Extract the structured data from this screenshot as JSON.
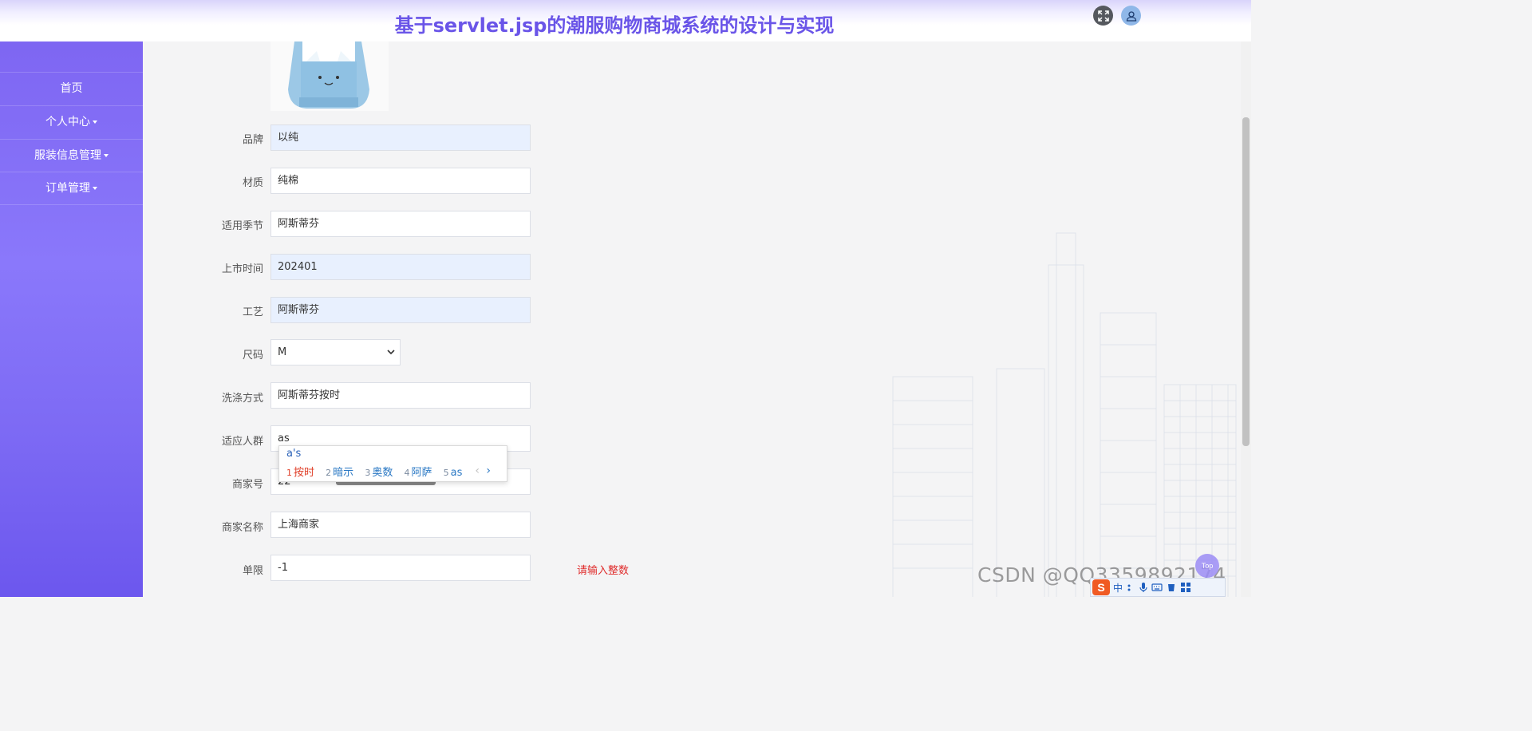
{
  "header": {
    "title": "基于servlet.jsp的潮服购物商城系统的设计与实现",
    "fullscreen_icon": "fullscreen-icon",
    "user_icon": "user-icon"
  },
  "sidebar": {
    "items": [
      {
        "label": "首页",
        "has_dropdown": false
      },
      {
        "label": "个人中心",
        "has_dropdown": true
      },
      {
        "label": "服装信息管理",
        "has_dropdown": true
      },
      {
        "label": "订单管理",
        "has_dropdown": true
      }
    ]
  },
  "form": {
    "fields": [
      {
        "label": "品牌",
        "value": "以纯"
      },
      {
        "label": "材质",
        "value": "纯棉"
      },
      {
        "label": "适用季节",
        "value": "阿斯蒂芬"
      },
      {
        "label": "上市时间",
        "value": "202401"
      },
      {
        "label": "工艺",
        "value": "阿斯蒂芬"
      },
      {
        "label": "尺码",
        "value": "M"
      },
      {
        "label": "洗涤方式",
        "value": "阿斯蒂芬按时"
      },
      {
        "label": "适应人群",
        "value": "as"
      },
      {
        "label": "商家号",
        "value": "22"
      },
      {
        "label": "商家名称",
        "value": "上海商家"
      },
      {
        "label": "单限",
        "value": "-1"
      }
    ],
    "error_message": "请输入整数"
  },
  "ime": {
    "composition": "a's",
    "candidates": [
      {
        "num": "1",
        "text": "按时"
      },
      {
        "num": "2",
        "text": "暗示"
      },
      {
        "num": "3",
        "text": "奥数"
      },
      {
        "num": "4",
        "text": "阿萨"
      },
      {
        "num": "5",
        "text": "as"
      }
    ],
    "prev": "‹",
    "next": "›"
  },
  "watermark": "CSDN @QQ3359892174",
  "float_ball": "Top",
  "ime_toolbar": {
    "logo": "S",
    "lang": "中"
  },
  "colors": {
    "accent": "#6a55e8",
    "sidebar": "#8a78fb",
    "error": "#e02d2d"
  }
}
